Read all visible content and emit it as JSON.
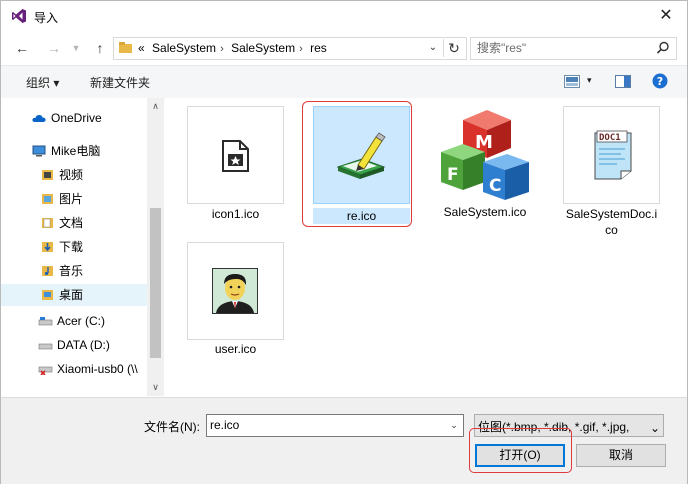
{
  "window": {
    "title": "导入"
  },
  "nav": {
    "breadcrumbs": [
      "«",
      "SaleSystem",
      "SaleSystem",
      "res"
    ],
    "search_placeholder": "搜索\"res\""
  },
  "toolbar": {
    "organize": "组织 ▾",
    "new_folder": "新建文件夹"
  },
  "sidebar": {
    "items": [
      {
        "label": "OneDrive",
        "icon": "cloud-icon"
      },
      {
        "label": "Mike电脑",
        "icon": "computer-icon"
      },
      {
        "label": "视频",
        "icon": "video-folder-icon"
      },
      {
        "label": "图片",
        "icon": "pictures-folder-icon"
      },
      {
        "label": "文档",
        "icon": "documents-folder-icon"
      },
      {
        "label": "下载",
        "icon": "downloads-folder-icon"
      },
      {
        "label": "音乐",
        "icon": "music-folder-icon"
      },
      {
        "label": "桌面",
        "icon": "desktop-folder-icon",
        "selected": true
      },
      {
        "label": "Acer (C:)",
        "icon": "drive-icon"
      },
      {
        "label": "DATA (D:)",
        "icon": "drive-icon"
      },
      {
        "label": "Xiaomi-usb0 (\\\\",
        "icon": "network-drive-icon"
      }
    ]
  },
  "files": [
    {
      "name": "icon1.ico",
      "icon": "icon1-file-icon"
    },
    {
      "name": "re.ico",
      "icon": "re-file-icon",
      "selected": true
    },
    {
      "name": "SaleSystem.ico",
      "icon": "mfc-cubes-icon"
    },
    {
      "name": "SaleSystemDoc.i",
      "name2": "co",
      "icon": "doc-file-icon"
    },
    {
      "name": "user.ico",
      "icon": "user-portrait-icon"
    }
  ],
  "bottom": {
    "filename_label": "文件名(N):",
    "filename_value": "re.ico",
    "filetype": "位图(*.bmp, *.dib, *.gif, *.jpg,",
    "open_label": "打开(O)",
    "cancel_label": "取消"
  },
  "colors": {
    "selection": "#cce8ff",
    "highlight_box": "#e03a3a",
    "accent": "#0078d7"
  }
}
